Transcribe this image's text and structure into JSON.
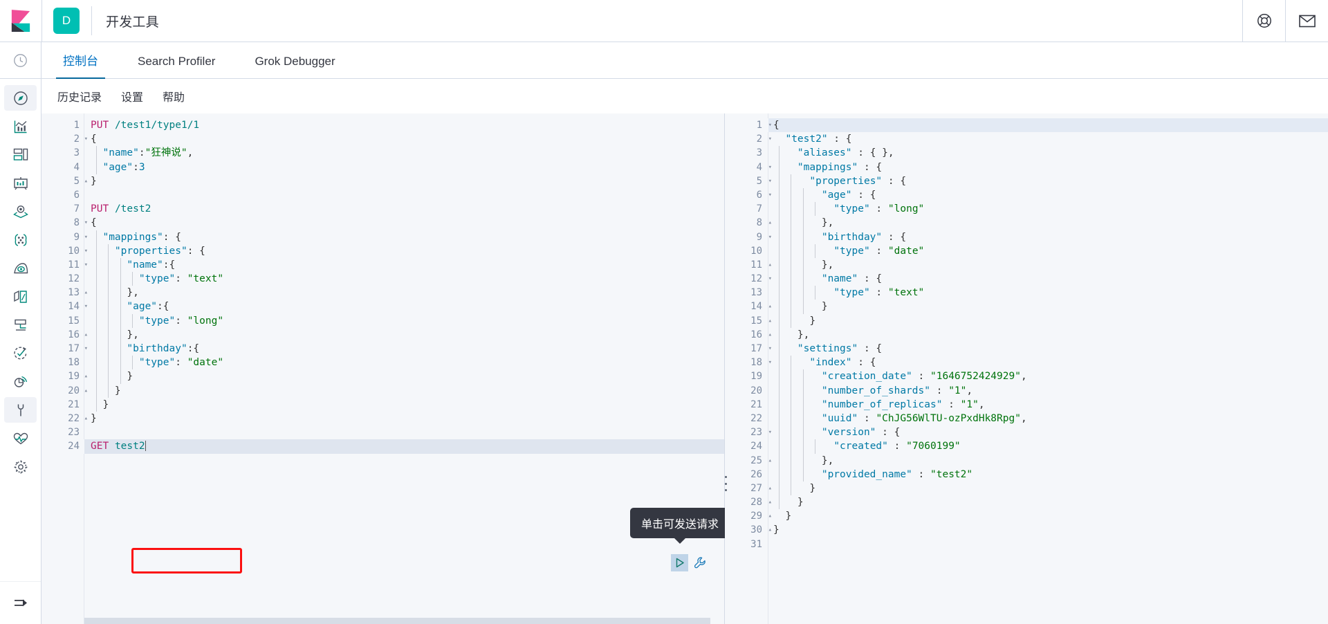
{
  "header": {
    "space_badge": "D",
    "app_title": "开发工具",
    "help_icon": "lifebuoy-help-icon",
    "mail_icon": "envelope-icon",
    "logo_icon": "kibana-logo-icon"
  },
  "nav_rail": {
    "recent_icon": "clock-recently-viewed-icon",
    "collapse_label": "collapse-nav-icon",
    "items": [
      {
        "name": "discover",
        "icon": "compass-discover-icon",
        "active": true
      },
      {
        "name": "visualize",
        "icon": "chart-visualize-icon",
        "active": false
      },
      {
        "name": "dashboard",
        "icon": "dashboard-panels-icon",
        "active": false
      },
      {
        "name": "canvas",
        "icon": "canvas-presentation-icon",
        "active": false
      },
      {
        "name": "maps",
        "icon": "map-layers-icon",
        "active": false
      },
      {
        "name": "machine-learning",
        "icon": "machine-learning-icon",
        "active": false
      },
      {
        "name": "graph",
        "icon": "graph-eye-icon",
        "active": false
      },
      {
        "name": "metrics",
        "icon": "metrics-pages-icon",
        "active": false
      },
      {
        "name": "logs",
        "icon": "logs-stack-icon",
        "active": false
      },
      {
        "name": "uptime",
        "icon": "uptime-check-icon",
        "active": false
      },
      {
        "name": "apm",
        "icon": "apm-signal-icon",
        "active": false
      },
      {
        "name": "dev-tools",
        "icon": "wrench-dev-tools-icon",
        "active": true
      },
      {
        "name": "stack-monitoring",
        "icon": "heartbeat-monitoring-icon",
        "active": false
      },
      {
        "name": "management",
        "icon": "gear-management-icon",
        "active": false
      }
    ]
  },
  "tabs": [
    {
      "label": "控制台",
      "active": true
    },
    {
      "label": "Search Profiler",
      "active": false
    },
    {
      "label": "Grok Debugger",
      "active": false
    }
  ],
  "submenu": [
    {
      "label": "历史记录"
    },
    {
      "label": "设置"
    },
    {
      "label": "帮助"
    }
  ],
  "tooltip": {
    "text": "单击可发送请求"
  },
  "buttons": {
    "play_icon": "play-send-request-icon",
    "wrench_icon": "wrench-options-icon",
    "resizer": "pane-resizer-handle"
  },
  "colors": {
    "accent": "#0071c2",
    "tab_underline": "#07689c",
    "space_badge_bg": "#00bfb3",
    "annotation_red": "#fb1010",
    "method": "#b9216e",
    "url": "#008080",
    "key": "#0079a5",
    "string": "#00730c",
    "highlight_row": "#dfe5ef",
    "editor_bg": "#f5f7fa",
    "tooltip_bg": "#343741"
  },
  "request_editor": {
    "name": "console-request-editor",
    "cursor_line": 24,
    "lines": [
      {
        "n": 1,
        "fold": "",
        "indent": 0,
        "tokens": [
          {
            "t": "PUT",
            "c": "m"
          },
          {
            "t": " ",
            "c": "p"
          },
          {
            "t": "/test1/type1/1",
            "c": "u"
          }
        ]
      },
      {
        "n": 2,
        "fold": "▾",
        "indent": 0,
        "tokens": [
          {
            "t": "{",
            "c": "p"
          }
        ]
      },
      {
        "n": 3,
        "fold": "",
        "indent": 1,
        "tokens": [
          {
            "t": "  ",
            "c": "p"
          },
          {
            "t": "\"name\"",
            "c": "k"
          },
          {
            "t": ":",
            "c": "p"
          },
          {
            "t": "\"狂神说\"",
            "c": "s"
          },
          {
            "t": ",",
            "c": "p"
          }
        ]
      },
      {
        "n": 4,
        "fold": "",
        "indent": 1,
        "tokens": [
          {
            "t": "  ",
            "c": "p"
          },
          {
            "t": "\"age\"",
            "c": "k"
          },
          {
            "t": ":",
            "c": "p"
          },
          {
            "t": "3",
            "c": "n"
          }
        ]
      },
      {
        "n": 5,
        "fold": "▴",
        "indent": 0,
        "tokens": [
          {
            "t": "}",
            "c": "p"
          }
        ]
      },
      {
        "n": 6,
        "fold": "",
        "indent": 0,
        "tokens": []
      },
      {
        "n": 7,
        "fold": "",
        "indent": 0,
        "tokens": [
          {
            "t": "PUT",
            "c": "m"
          },
          {
            "t": " ",
            "c": "p"
          },
          {
            "t": "/test2",
            "c": "u"
          }
        ]
      },
      {
        "n": 8,
        "fold": "▾",
        "indent": 0,
        "tokens": [
          {
            "t": "{",
            "c": "p"
          }
        ]
      },
      {
        "n": 9,
        "fold": "▾",
        "indent": 1,
        "tokens": [
          {
            "t": "  ",
            "c": "p"
          },
          {
            "t": "\"mappings\"",
            "c": "k"
          },
          {
            "t": ": {",
            "c": "p"
          }
        ]
      },
      {
        "n": 10,
        "fold": "▾",
        "indent": 2,
        "tokens": [
          {
            "t": "    ",
            "c": "p"
          },
          {
            "t": "\"properties\"",
            "c": "k"
          },
          {
            "t": ": {",
            "c": "p"
          }
        ]
      },
      {
        "n": 11,
        "fold": "▾",
        "indent": 3,
        "tokens": [
          {
            "t": "      ",
            "c": "p"
          },
          {
            "t": "\"name\"",
            "c": "k"
          },
          {
            "t": ":{",
            "c": "p"
          }
        ]
      },
      {
        "n": 12,
        "fold": "",
        "indent": 4,
        "tokens": [
          {
            "t": "        ",
            "c": "p"
          },
          {
            "t": "\"type\"",
            "c": "k"
          },
          {
            "t": ": ",
            "c": "p"
          },
          {
            "t": "\"text\"",
            "c": "s"
          }
        ]
      },
      {
        "n": 13,
        "fold": "▴",
        "indent": 3,
        "tokens": [
          {
            "t": "      },",
            "c": "p"
          }
        ]
      },
      {
        "n": 14,
        "fold": "▾",
        "indent": 3,
        "tokens": [
          {
            "t": "      ",
            "c": "p"
          },
          {
            "t": "\"age\"",
            "c": "k"
          },
          {
            "t": ":{",
            "c": "p"
          }
        ]
      },
      {
        "n": 15,
        "fold": "",
        "indent": 4,
        "tokens": [
          {
            "t": "        ",
            "c": "p"
          },
          {
            "t": "\"type\"",
            "c": "k"
          },
          {
            "t": ": ",
            "c": "p"
          },
          {
            "t": "\"long\"",
            "c": "s"
          }
        ]
      },
      {
        "n": 16,
        "fold": "▴",
        "indent": 3,
        "tokens": [
          {
            "t": "      },",
            "c": "p"
          }
        ]
      },
      {
        "n": 17,
        "fold": "▾",
        "indent": 3,
        "tokens": [
          {
            "t": "      ",
            "c": "p"
          },
          {
            "t": "\"birthday\"",
            "c": "k"
          },
          {
            "t": ":{",
            "c": "p"
          }
        ]
      },
      {
        "n": 18,
        "fold": "",
        "indent": 4,
        "tokens": [
          {
            "t": "        ",
            "c": "p"
          },
          {
            "t": "\"type\"",
            "c": "k"
          },
          {
            "t": ": ",
            "c": "p"
          },
          {
            "t": "\"date\"",
            "c": "s"
          }
        ]
      },
      {
        "n": 19,
        "fold": "▴",
        "indent": 3,
        "tokens": [
          {
            "t": "      }",
            "c": "p"
          }
        ]
      },
      {
        "n": 20,
        "fold": "▴",
        "indent": 2,
        "tokens": [
          {
            "t": "    }",
            "c": "p"
          }
        ]
      },
      {
        "n": 21,
        "fold": "",
        "indent": 1,
        "tokens": [
          {
            "t": "  }",
            "c": "p"
          }
        ]
      },
      {
        "n": 22,
        "fold": "▴",
        "indent": 0,
        "tokens": [
          {
            "t": "}",
            "c": "p"
          }
        ]
      },
      {
        "n": 23,
        "fold": "",
        "indent": 0,
        "tokens": []
      },
      {
        "n": 24,
        "fold": "",
        "indent": 0,
        "tokens": [
          {
            "t": "GET",
            "c": "m"
          },
          {
            "t": " ",
            "c": "p"
          },
          {
            "t": "test2",
            "c": "u"
          }
        ]
      }
    ]
  },
  "response_editor": {
    "name": "console-response-viewer",
    "lines": [
      {
        "n": 1,
        "fold": "▾",
        "indent": 0,
        "tokens": [
          {
            "t": "{",
            "c": "p"
          }
        ]
      },
      {
        "n": 2,
        "fold": "▾",
        "indent": 0,
        "tokens": [
          {
            "t": "  ",
            "c": "p"
          },
          {
            "t": "\"test2\"",
            "c": "k"
          },
          {
            "t": " : {",
            "c": "p"
          }
        ]
      },
      {
        "n": 3,
        "fold": "",
        "indent": 1,
        "tokens": [
          {
            "t": "    ",
            "c": "p"
          },
          {
            "t": "\"aliases\"",
            "c": "k"
          },
          {
            "t": " : { },",
            "c": "p"
          }
        ]
      },
      {
        "n": 4,
        "fold": "▾",
        "indent": 1,
        "tokens": [
          {
            "t": "    ",
            "c": "p"
          },
          {
            "t": "\"mappings\"",
            "c": "k"
          },
          {
            "t": " : {",
            "c": "p"
          }
        ]
      },
      {
        "n": 5,
        "fold": "▾",
        "indent": 2,
        "tokens": [
          {
            "t": "      ",
            "c": "p"
          },
          {
            "t": "\"properties\"",
            "c": "k"
          },
          {
            "t": " : {",
            "c": "p"
          }
        ]
      },
      {
        "n": 6,
        "fold": "▾",
        "indent": 3,
        "tokens": [
          {
            "t": "        ",
            "c": "p"
          },
          {
            "t": "\"age\"",
            "c": "k"
          },
          {
            "t": " : {",
            "c": "p"
          }
        ]
      },
      {
        "n": 7,
        "fold": "",
        "indent": 4,
        "tokens": [
          {
            "t": "          ",
            "c": "p"
          },
          {
            "t": "\"type\"",
            "c": "k"
          },
          {
            "t": " : ",
            "c": "p"
          },
          {
            "t": "\"long\"",
            "c": "s"
          }
        ]
      },
      {
        "n": 8,
        "fold": "▴",
        "indent": 3,
        "tokens": [
          {
            "t": "        },",
            "c": "p"
          }
        ]
      },
      {
        "n": 9,
        "fold": "▾",
        "indent": 3,
        "tokens": [
          {
            "t": "        ",
            "c": "p"
          },
          {
            "t": "\"birthday\"",
            "c": "k"
          },
          {
            "t": " : {",
            "c": "p"
          }
        ]
      },
      {
        "n": 10,
        "fold": "",
        "indent": 4,
        "tokens": [
          {
            "t": "          ",
            "c": "p"
          },
          {
            "t": "\"type\"",
            "c": "k"
          },
          {
            "t": " : ",
            "c": "p"
          },
          {
            "t": "\"date\"",
            "c": "s"
          }
        ]
      },
      {
        "n": 11,
        "fold": "▴",
        "indent": 3,
        "tokens": [
          {
            "t": "        },",
            "c": "p"
          }
        ]
      },
      {
        "n": 12,
        "fold": "▾",
        "indent": 3,
        "tokens": [
          {
            "t": "        ",
            "c": "p"
          },
          {
            "t": "\"name\"",
            "c": "k"
          },
          {
            "t": " : {",
            "c": "p"
          }
        ]
      },
      {
        "n": 13,
        "fold": "",
        "indent": 4,
        "tokens": [
          {
            "t": "          ",
            "c": "p"
          },
          {
            "t": "\"type\"",
            "c": "k"
          },
          {
            "t": " : ",
            "c": "p"
          },
          {
            "t": "\"text\"",
            "c": "s"
          }
        ]
      },
      {
        "n": 14,
        "fold": "▴",
        "indent": 3,
        "tokens": [
          {
            "t": "        }",
            "c": "p"
          }
        ]
      },
      {
        "n": 15,
        "fold": "▴",
        "indent": 2,
        "tokens": [
          {
            "t": "      }",
            "c": "p"
          }
        ]
      },
      {
        "n": 16,
        "fold": "▴",
        "indent": 1,
        "tokens": [
          {
            "t": "    },",
            "c": "p"
          }
        ]
      },
      {
        "n": 17,
        "fold": "▾",
        "indent": 1,
        "tokens": [
          {
            "t": "    ",
            "c": "p"
          },
          {
            "t": "\"settings\"",
            "c": "k"
          },
          {
            "t": " : {",
            "c": "p"
          }
        ]
      },
      {
        "n": 18,
        "fold": "▾",
        "indent": 2,
        "tokens": [
          {
            "t": "      ",
            "c": "p"
          },
          {
            "t": "\"index\"",
            "c": "k"
          },
          {
            "t": " : {",
            "c": "p"
          }
        ]
      },
      {
        "n": 19,
        "fold": "",
        "indent": 3,
        "tokens": [
          {
            "t": "        ",
            "c": "p"
          },
          {
            "t": "\"creation_date\"",
            "c": "k"
          },
          {
            "t": " : ",
            "c": "p"
          },
          {
            "t": "\"1646752424929\"",
            "c": "s"
          },
          {
            "t": ",",
            "c": "p"
          }
        ]
      },
      {
        "n": 20,
        "fold": "",
        "indent": 3,
        "tokens": [
          {
            "t": "        ",
            "c": "p"
          },
          {
            "t": "\"number_of_shards\"",
            "c": "k"
          },
          {
            "t": " : ",
            "c": "p"
          },
          {
            "t": "\"1\"",
            "c": "s"
          },
          {
            "t": ",",
            "c": "p"
          }
        ]
      },
      {
        "n": 21,
        "fold": "",
        "indent": 3,
        "tokens": [
          {
            "t": "        ",
            "c": "p"
          },
          {
            "t": "\"number_of_replicas\"",
            "c": "k"
          },
          {
            "t": " : ",
            "c": "p"
          },
          {
            "t": "\"1\"",
            "c": "s"
          },
          {
            "t": ",",
            "c": "p"
          }
        ]
      },
      {
        "n": 22,
        "fold": "",
        "indent": 3,
        "tokens": [
          {
            "t": "        ",
            "c": "p"
          },
          {
            "t": "\"uuid\"",
            "c": "k"
          },
          {
            "t": " : ",
            "c": "p"
          },
          {
            "t": "\"ChJG56WlTU-ozPxdHk8Rpg\"",
            "c": "s"
          },
          {
            "t": ",",
            "c": "p"
          }
        ]
      },
      {
        "n": 23,
        "fold": "▾",
        "indent": 3,
        "tokens": [
          {
            "t": "        ",
            "c": "p"
          },
          {
            "t": "\"version\"",
            "c": "k"
          },
          {
            "t": " : {",
            "c": "p"
          }
        ]
      },
      {
        "n": 24,
        "fold": "",
        "indent": 4,
        "tokens": [
          {
            "t": "          ",
            "c": "p"
          },
          {
            "t": "\"created\"",
            "c": "k"
          },
          {
            "t": " : ",
            "c": "p"
          },
          {
            "t": "\"7060199\"",
            "c": "s"
          }
        ]
      },
      {
        "n": 25,
        "fold": "▴",
        "indent": 3,
        "tokens": [
          {
            "t": "        },",
            "c": "p"
          }
        ]
      },
      {
        "n": 26,
        "fold": "",
        "indent": 3,
        "tokens": [
          {
            "t": "        ",
            "c": "p"
          },
          {
            "t": "\"provided_name\"",
            "c": "k"
          },
          {
            "t": " : ",
            "c": "p"
          },
          {
            "t": "\"test2\"",
            "c": "s"
          }
        ]
      },
      {
        "n": 27,
        "fold": "▴",
        "indent": 2,
        "tokens": [
          {
            "t": "      }",
            "c": "p"
          }
        ]
      },
      {
        "n": 28,
        "fold": "▴",
        "indent": 1,
        "tokens": [
          {
            "t": "    }",
            "c": "p"
          }
        ]
      },
      {
        "n": 29,
        "fold": "▴",
        "indent": 0,
        "tokens": [
          {
            "t": "  }",
            "c": "p"
          }
        ]
      },
      {
        "n": 30,
        "fold": "▴",
        "indent": 0,
        "tokens": [
          {
            "t": "}",
            "c": "p"
          }
        ]
      },
      {
        "n": 31,
        "fold": "",
        "indent": 0,
        "tokens": []
      }
    ]
  }
}
